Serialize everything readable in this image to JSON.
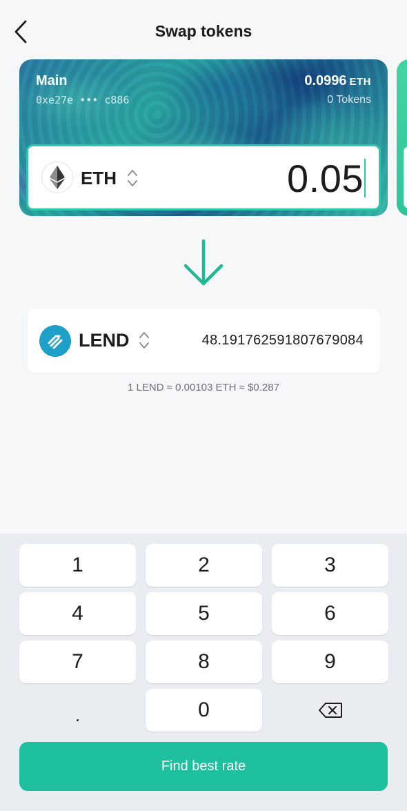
{
  "header": {
    "title": "Swap tokens"
  },
  "wallet": {
    "name": "Main",
    "address": "0xe27e ••• c886",
    "balance": "0.0996",
    "balance_unit": "ETH",
    "tokens": "0 Tokens"
  },
  "from": {
    "symbol": "ETH",
    "amount": "0.05"
  },
  "to": {
    "symbol": "LEND",
    "amount": "48.19176259180767908​4"
  },
  "rate": "1 LEND ≈ 0.00103 ETH ≈ $0.287",
  "keypad": {
    "keys": [
      "1",
      "2",
      "3",
      "4",
      "5",
      "6",
      "7",
      "8",
      "9",
      ".",
      "0"
    ]
  },
  "cta": {
    "label": "Find best rate"
  },
  "colors": {
    "accent": "#1fc09e",
    "lend": "#1ea0c8"
  }
}
